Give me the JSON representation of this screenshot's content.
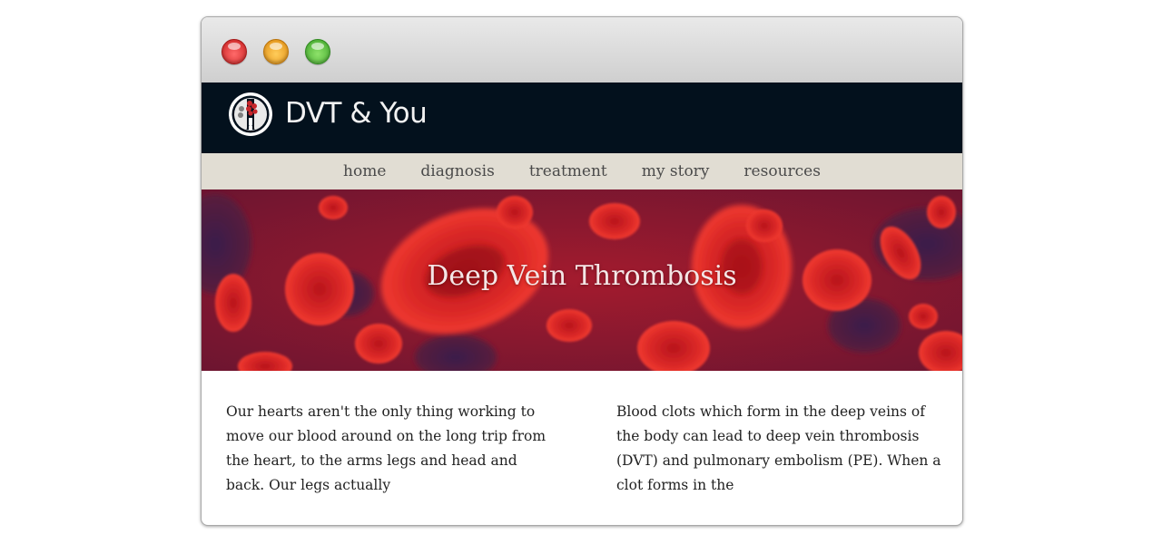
{
  "brand": {
    "name": "DVT & You",
    "logo_icon": "blood-cells-vein-logo-icon"
  },
  "nav": {
    "items": [
      {
        "label": "home"
      },
      {
        "label": "diagnosis"
      },
      {
        "label": "treatment"
      },
      {
        "label": "my story"
      },
      {
        "label": "resources"
      }
    ]
  },
  "hero": {
    "title": "Deep Vein Thrombosis"
  },
  "content": {
    "left_paragraph": "Our hearts aren't the only thing working to move our blood around on the long trip from the heart, to the arms legs and head and back. Our legs actually",
    "right_paragraph": "Blood clots which form in the deep veins of the body can lead to deep vein thrombosis (DVT) and pulmonary embolism (PE). When a clot forms in the"
  },
  "colors": {
    "header_bg": "#03111d",
    "nav_bg": "#e1ddd3",
    "hero_bg": "#8d1a2c",
    "cell_red": "#d42a2a"
  }
}
